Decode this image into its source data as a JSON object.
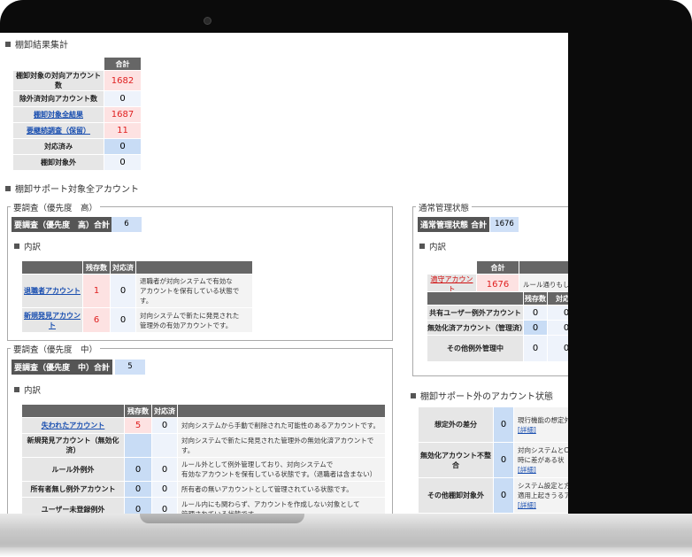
{
  "summary": {
    "title": "棚卸結果集計",
    "col_total": "合計",
    "rows": [
      {
        "label": "棚卸対象の対向アカウント数",
        "value": "1682",
        "link": false,
        "style": "pink"
      },
      {
        "label": "除外済対向アカウント数",
        "value": "0",
        "link": false,
        "style": "plain"
      },
      {
        "label": "棚卸対象全結果",
        "value": "1687",
        "link": true,
        "style": "pink"
      },
      {
        "label": "要継続調査（保留）",
        "value": "11",
        "link": true,
        "style": "pink"
      },
      {
        "label": "対応済み",
        "value": "0",
        "link": false,
        "style": "blue"
      },
      {
        "label": "棚卸対象外",
        "value": "0",
        "link": false,
        "style": "plain"
      }
    ]
  },
  "support_title": "棚卸サポート対象全アカウント",
  "high": {
    "legend": "要調査（優先度　高）",
    "total_label": "要調査（優先度　高）合計",
    "total_value": "6",
    "breakdown": "内訳",
    "col_remaining": "残存数",
    "col_done": "対応済",
    "rows": [
      {
        "label": "退職者アカウント",
        "remaining": "1",
        "done": "0",
        "desc": "退職者が対向システムで有効な\nアカウントを保有している状態です。"
      },
      {
        "label": "新規発見アカウント",
        "remaining": "6",
        "done": "0",
        "desc": "対向システムで新たに発見された\n管理外の有効アカウントです。"
      }
    ]
  },
  "mid": {
    "legend": "要調査（優先度　中）",
    "total_label": "要調査（優先度　中）合計",
    "total_value": "5",
    "breakdown": "内訳",
    "col_remaining": "残存数",
    "col_done": "対応済",
    "rows": [
      {
        "label": "失われたアカウント",
        "link": true,
        "remaining": "5",
        "done": "0",
        "desc": "対向システムから手動で削除された可能性のあるアカウントです。"
      },
      {
        "label": "新規発見アカウント（無効化済）",
        "link": false,
        "remaining": "",
        "done": "",
        "desc": "対向システムで新たに発見された管理外の無効化済アカウントです。"
      },
      {
        "label": "ルール外例外",
        "link": false,
        "remaining": "0",
        "done": "0",
        "desc": "ルール外として例外管理しており、対向システムで\n有効なアカウントを保有している状態です。（退職者は含まない）"
      },
      {
        "label": "所有者無し例外アカウント",
        "link": false,
        "remaining": "0",
        "done": "0",
        "desc": "所有者の無いアカウントとして管理されている状態です。"
      },
      {
        "label": "ユーザー未登録例外",
        "link": false,
        "remaining": "0",
        "done": "0",
        "desc": "ルール内にも関わらず、アカウントを作成しない対象として\n管理されている状態です。"
      }
    ]
  },
  "normal": {
    "legend": "通常管理状態",
    "total_label": "通常管理状態 合計",
    "total_value": "1676",
    "breakdown": "内訳",
    "col_total": "合計",
    "row": {
      "label": "適守アカウント",
      "value": "1676",
      "desc": "ルール通りもしく"
    },
    "col_remaining": "残存数",
    "col_done": "対応済",
    "rows": [
      {
        "label": "共有ユーザー例外アカウント",
        "remaining": "0",
        "done": "0"
      },
      {
        "label": "無効化済アカウント（管理済）",
        "remaining": "0",
        "done": "0"
      },
      {
        "label": "その他例外管理中",
        "remaining": "0",
        "done": "0"
      }
    ]
  },
  "outside": {
    "title": "棚卸サポート外のアカウント状態",
    "rows": [
      {
        "label": "想定外の差分",
        "value": "0",
        "desc": "現行機能の想定外",
        "detail": "[詳細]"
      },
      {
        "label": "無効化アカウント不整合",
        "value": "0",
        "desc": "対向システムとC\n時に差がある状",
        "detail": "[詳細]"
      },
      {
        "label": "その他棚卸対象外",
        "value": "0",
        "desc": "システム設定と方\n適用上起きうるア",
        "detail": "[詳細]"
      }
    ]
  }
}
